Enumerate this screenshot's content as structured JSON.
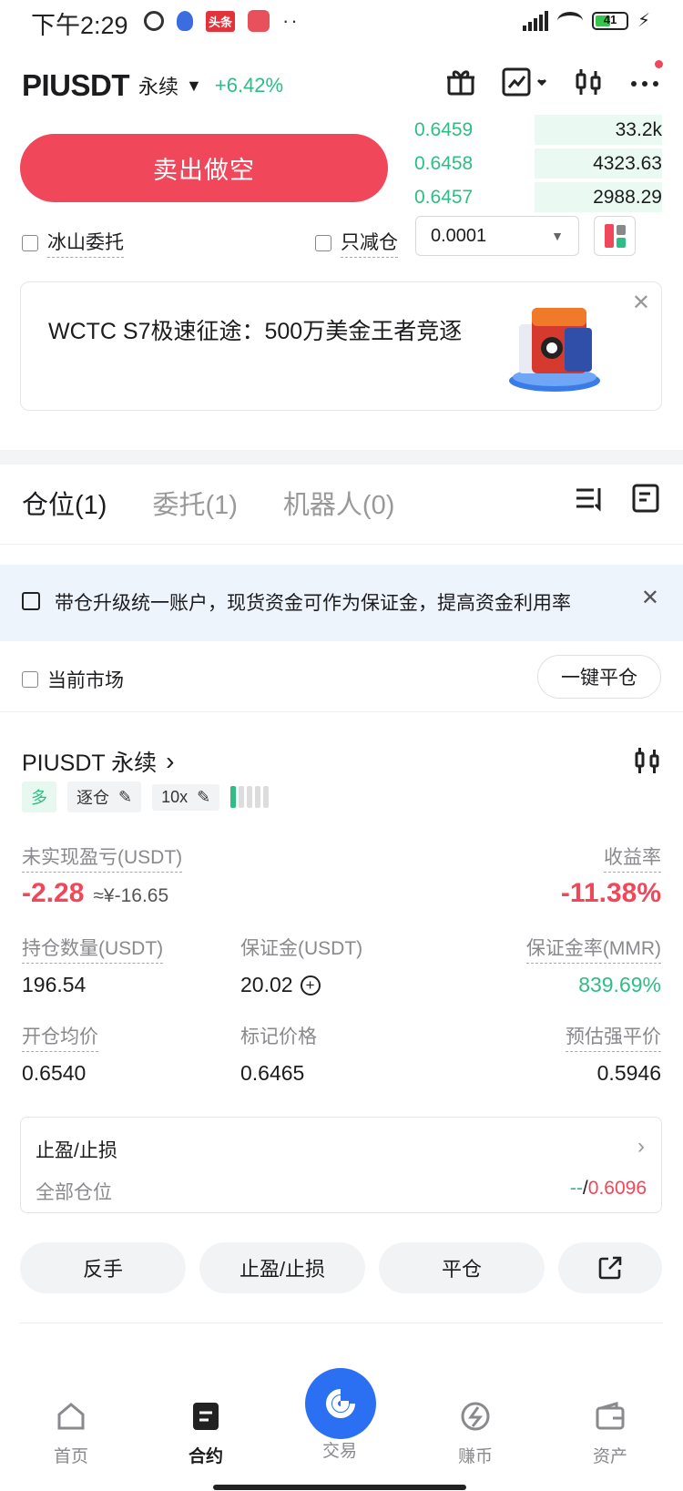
{
  "status_bar": {
    "time": "下午2:29",
    "badge": "头条",
    "battery": "41"
  },
  "header": {
    "pair": "PIUSDT",
    "type": "永续",
    "change": "+6.42%"
  },
  "sell_button": "卖出做空",
  "orderbook": {
    "rows": [
      {
        "price": "0.6459",
        "qty": "33.2k"
      },
      {
        "price": "0.6458",
        "qty": "4323.63"
      },
      {
        "price": "0.6457",
        "qty": "2988.29"
      }
    ]
  },
  "options": {
    "iceberg": "冰山委托",
    "reduce_only": "只减仓",
    "tick_size": "0.0001"
  },
  "banner": {
    "text": "WCTC S7极速征途：500万美金王者竞逐"
  },
  "tabs": {
    "positions": "仓位(1)",
    "orders": "委托(1)",
    "bots": "机器人(0)"
  },
  "notice": {
    "text": "带仓升级统一账户，现货资金可作为保证金，提高资金利用率"
  },
  "filter": {
    "current_market": "当前市场",
    "close_all": "一键平仓"
  },
  "position": {
    "title": "PIUSDT 永续",
    "side": "多",
    "margin_mode": "逐仓",
    "leverage": "10x",
    "unrealized_pnl_label": "未实现盈亏(USDT)",
    "unrealized_pnl": "-2.28",
    "unrealized_pnl_cny": "≈¥-16.65",
    "roe_label": "收益率",
    "roe": "-11.38%",
    "size_label": "持仓数量(USDT)",
    "size": "196.54",
    "margin_label": "保证金(USDT)",
    "margin": "20.02",
    "mmr_label": "保证金率(MMR)",
    "mmr": "839.69%",
    "entry_label": "开仓均价",
    "entry": "0.6540",
    "mark_label": "标记价格",
    "mark": "0.6465",
    "liq_label": "预估强平价",
    "liq": "0.5946",
    "tpsl_title": "止盈/止损",
    "tpsl_scope": "全部仓位",
    "tp_value": "--",
    "sl_value": "0.6096"
  },
  "actions": {
    "reverse": "反手",
    "tpsl": "止盈/止损",
    "close": "平仓"
  },
  "bottom_nav": {
    "home": "首页",
    "futures": "合约",
    "trade": "交易",
    "earn": "赚币",
    "assets": "资产"
  }
}
